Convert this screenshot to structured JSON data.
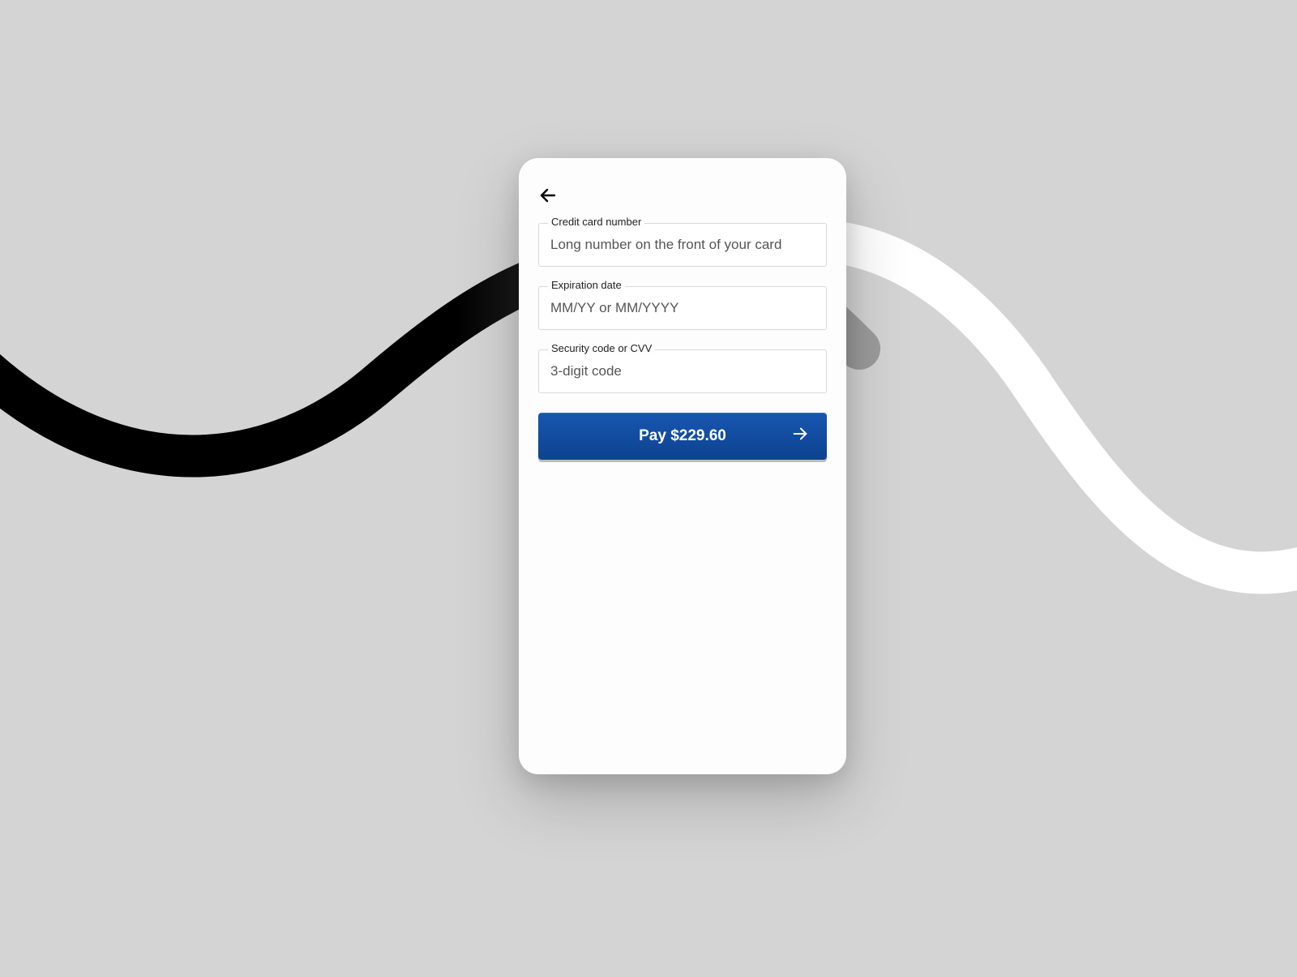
{
  "form": {
    "card_number": {
      "label": "Credit card number",
      "placeholder": "Long number on the front of your card",
      "value": ""
    },
    "expiration": {
      "label": "Expiration date",
      "placeholder": "MM/YY or MM/YYYY",
      "value": ""
    },
    "cvv": {
      "label": "Security code or CVV",
      "placeholder": "3-digit code",
      "value": ""
    }
  },
  "pay_button": {
    "label": "Pay $229.60"
  },
  "colors": {
    "primary": "#0f4fa8",
    "page_bg": "#d4d4d4"
  }
}
